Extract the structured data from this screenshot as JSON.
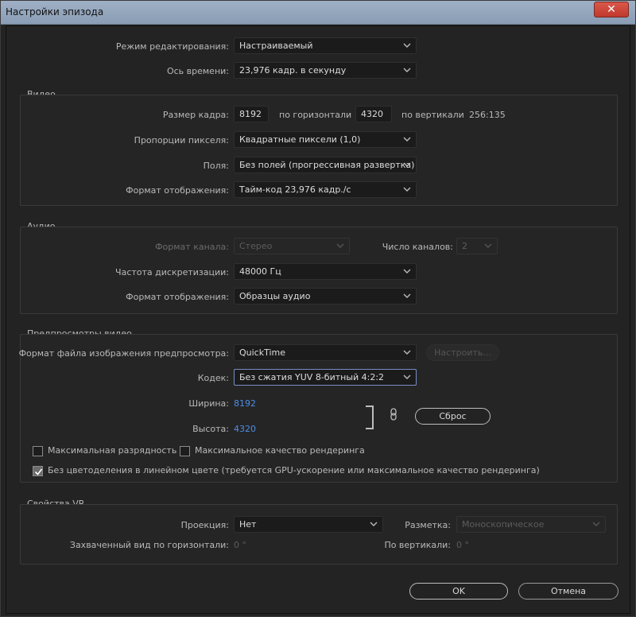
{
  "window": {
    "title": "Настройки эпизода",
    "close_glyph": "✕"
  },
  "main": {
    "edit_mode": {
      "label": "Режим редактирования:",
      "value": "Настраиваемый"
    },
    "timebase": {
      "label": "Ось времени:",
      "value": "23,976  кадр. в секунду"
    }
  },
  "video": {
    "title": "Видео",
    "frame_size": {
      "label": "Размер кадра:",
      "width": "8192",
      "h_label": "по горизонтали",
      "height": "4320",
      "v_label": "по вертикали",
      "ratio": "256:135"
    },
    "pixel_aspect": {
      "label": "Пропорции пикселя:",
      "value": "Квадратные пиксели (1,0)"
    },
    "fields": {
      "label": "Поля:",
      "value": "Без полей (прогрессивная развертка)"
    },
    "display_format": {
      "label": "Формат отображения:",
      "value": "Тайм-код 23,976 кадр./с"
    }
  },
  "audio": {
    "title": "Аудио",
    "channel_format": {
      "label": "Формат канала:",
      "value": "Стерео"
    },
    "channels": {
      "label": "Число каналов:",
      "value": "2"
    },
    "sample_rate": {
      "label": "Частота дискретизации:",
      "value": "48000 Гц"
    },
    "display_format": {
      "label": "Формат отображения:",
      "value": "Образцы аудио"
    }
  },
  "preview": {
    "title": "Предпросмотры видео",
    "file_format": {
      "label": "Формат файла изображения предпросмотра:",
      "value": "QuickTime"
    },
    "configure_label": "Настроить...",
    "codec": {
      "label": "Кодек:",
      "value": "Без сжатия YUV 8-битный 4:2:2"
    },
    "width": {
      "label": "Ширина:",
      "value": "8192"
    },
    "height": {
      "label": "Высота:",
      "value": "4320"
    },
    "reset_label": "Сброс",
    "max_bit_depth": {
      "label": "Максимальная разрядность",
      "checked": false
    },
    "max_render_quality": {
      "label": "Максимальное качество рендеринга",
      "checked": false
    },
    "linear_color": {
      "label": "Без цветоделения в линейном цвете (требуется GPU-ускорение или максимальное качество рендеринга)",
      "checked": true
    }
  },
  "vr": {
    "title": "Свойства VR",
    "projection": {
      "label": "Проекция:",
      "value": "Нет"
    },
    "layout": {
      "label": "Разметка:",
      "value": "Моноскопическое"
    },
    "captured_h": {
      "label": "Захваченный вид по горизонтали:",
      "value": "0 °"
    },
    "vertical": {
      "label": "По вертикали:",
      "value": "0 °"
    }
  },
  "buttons": {
    "ok": "OK",
    "cancel": "Отмена"
  },
  "colors": {
    "accent_value": "#4d8fe6",
    "titlebar": "#9fb0c6",
    "close": "#c0392b"
  }
}
